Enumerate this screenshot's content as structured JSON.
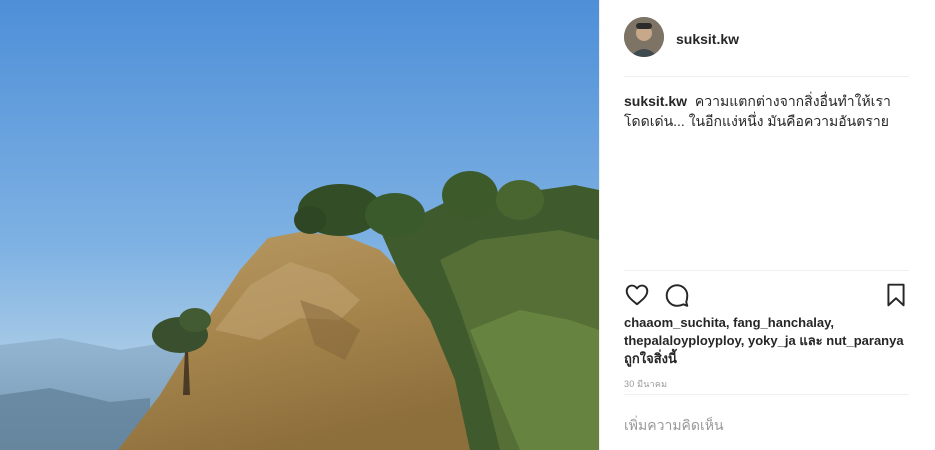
{
  "post": {
    "username": "suksit.kw",
    "caption": {
      "user": "suksit.kw",
      "text": "ความแตกต่างจากสิ่งอื่นทำให้เราโดดเด่น... ในอีกแง่หนึ่ง มันคือความอันตราย"
    },
    "likes": {
      "users": [
        "chaaom_suchita",
        "fang_hanchalay",
        "thepalaloyployploy",
        "yoky_ja",
        "nut_paranya"
      ],
      "sep1": ", ",
      "sep2": ", ",
      "sep3": ", ",
      "and_word": " และ ",
      "suffix": "ถูกใจสิ่งนี้"
    },
    "timestamp": "30 มีนาคม",
    "comment_placeholder": "เพิ่มความคิดเห็น"
  },
  "icons": {
    "like": "heart-outline-icon",
    "comment": "speech-bubble-icon",
    "save": "bookmark-icon"
  },
  "colors": {
    "text": "#262626",
    "muted": "#999999",
    "divider": "#efefef",
    "sky": "#5a97d6"
  }
}
